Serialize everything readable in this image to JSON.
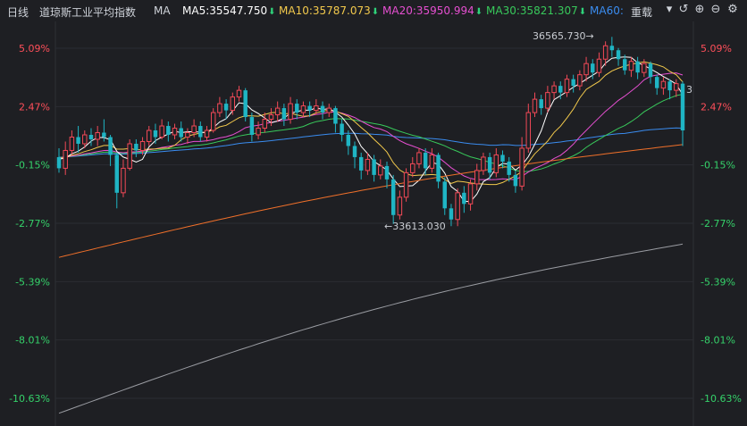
{
  "toolbar": {
    "period": "日线",
    "index_name": "道琼斯工业平均指数",
    "indicator": "MA",
    "ma5": "MA5:35547.750",
    "ma10": "MA10:35787.073",
    "ma20": "MA20:35950.994",
    "ma30": "MA30:35821.307",
    "ma60": "MA60:",
    "reset_label": "重载",
    "icons": [
      "undo-icon",
      "zoom-in-icon",
      "zoom-out-icon",
      "settings-icon"
    ]
  },
  "colors": {
    "background": "#1e1f23",
    "up": "#f24957",
    "down": "#1fb5c4",
    "ma5": "#ffffff",
    "ma10": "#f2c94c",
    "ma20": "#e64fd1",
    "ma30": "#38c95b",
    "ma60": "#3a8cf0",
    "ma120": "#f0702a",
    "ma250": "#9a9ca2",
    "up_text": "#ff4f5a",
    "down_text": "#35d26a"
  },
  "chart_data": {
    "type": "candlestick",
    "title": "道琼斯工业平均指数",
    "y_axis_ticks_left": [
      "5.09%",
      "2.47%",
      "-0.15%",
      "-2.77%",
      "-5.39%",
      "-8.01%",
      "-10.63%"
    ],
    "y_axis_ticks_right": [
      "5.09%",
      "2.47%",
      "-0.15%",
      "-2.77%",
      "-5.39%",
      "-8.01%",
      "-10.63%"
    ],
    "tick_values_pct": [
      5.09,
      2.47,
      -0.15,
      -2.77,
      -5.39,
      -8.01,
      -10.63
    ],
    "ylim_pct": [
      -11.2,
      5.6
    ],
    "annotations": {
      "high_label": "36565.730→",
      "high_value": 36565.73,
      "low_label": "←33613.030",
      "low_value": 33613.03,
      "right_edge_label": "3"
    },
    "candles": [
      [
        0.2,
        -0.3,
        0.6,
        -0.5
      ],
      [
        -0.3,
        0.5,
        0.9,
        -0.6
      ],
      [
        0.5,
        1.1,
        1.4,
        0.3
      ],
      [
        1.1,
        0.8,
        1.6,
        0.4
      ],
      [
        0.8,
        1.2,
        1.4,
        0.6
      ],
      [
        1.2,
        1.0,
        1.5,
        0.7
      ],
      [
        1.0,
        1.3,
        1.6,
        0.7
      ],
      [
        1.3,
        1.1,
        1.9,
        0.9
      ],
      [
        1.1,
        0.3,
        1.2,
        -0.2
      ],
      [
        0.3,
        -1.4,
        0.4,
        -2.1
      ],
      [
        -1.4,
        -0.3,
        0.1,
        -1.6
      ],
      [
        -0.3,
        0.8,
        1.0,
        -0.4
      ],
      [
        0.8,
        0.5,
        1.0,
        0.2
      ],
      [
        0.5,
        0.9,
        1.1,
        0.3
      ],
      [
        0.9,
        1.4,
        1.6,
        0.7
      ],
      [
        1.4,
        1.1,
        1.7,
        0.8
      ],
      [
        1.1,
        1.6,
        1.9,
        1.0
      ],
      [
        1.6,
        1.2,
        1.8,
        0.9
      ],
      [
        1.2,
        1.5,
        1.7,
        1.0
      ],
      [
        1.5,
        1.1,
        1.8,
        0.9
      ],
      [
        1.1,
        1.3,
        1.5,
        0.8
      ],
      [
        1.3,
        1.6,
        1.9,
        1.1
      ],
      [
        1.6,
        1.1,
        1.8,
        0.9
      ],
      [
        1.1,
        1.4,
        1.6,
        0.9
      ],
      [
        1.4,
        2.2,
        2.4,
        1.3
      ],
      [
        2.2,
        2.6,
        2.9,
        2.0
      ],
      [
        2.6,
        2.3,
        2.8,
        1.9
      ],
      [
        2.3,
        2.9,
        3.1,
        2.1
      ],
      [
        2.9,
        3.2,
        3.4,
        2.7
      ],
      [
        3.2,
        2.0,
        3.3,
        1.8
      ],
      [
        2.0,
        1.2,
        2.2,
        0.9
      ],
      [
        1.2,
        1.5,
        1.8,
        1.0
      ],
      [
        1.5,
        1.9,
        2.2,
        1.3
      ],
      [
        1.9,
        2.1,
        2.4,
        1.6
      ],
      [
        2.1,
        2.4,
        2.7,
        1.8
      ],
      [
        2.4,
        1.9,
        2.6,
        1.6
      ],
      [
        1.9,
        2.6,
        2.9,
        1.7
      ],
      [
        2.6,
        2.2,
        2.8,
        1.9
      ],
      [
        2.2,
        2.5,
        2.7,
        2.0
      ],
      [
        2.5,
        2.3,
        2.7,
        2.0
      ],
      [
        2.3,
        2.5,
        2.8,
        2.1
      ],
      [
        2.5,
        2.2,
        2.7,
        1.9
      ],
      [
        2.2,
        2.4,
        2.6,
        2.0
      ],
      [
        2.4,
        1.7,
        2.5,
        1.3
      ],
      [
        1.7,
        1.2,
        1.9,
        0.9
      ],
      [
        1.2,
        0.7,
        1.4,
        0.3
      ],
      [
        0.7,
        0.2,
        0.9,
        -0.3
      ],
      [
        0.2,
        -0.4,
        0.4,
        -0.8
      ],
      [
        -0.4,
        0.1,
        0.4,
        -0.6
      ],
      [
        0.1,
        -0.6,
        0.3,
        -0.9
      ],
      [
        -0.6,
        -0.2,
        0.1,
        -0.8
      ],
      [
        -0.2,
        -0.8,
        0.0,
        -1.2
      ],
      [
        -0.8,
        -2.4,
        -0.6,
        -2.8
      ],
      [
        -2.4,
        -1.6,
        -1.3,
        -2.6
      ],
      [
        -1.6,
        -0.5,
        -0.3,
        -1.8
      ],
      [
        -0.5,
        -0.1,
        0.2,
        -0.7
      ],
      [
        -0.1,
        0.4,
        0.6,
        -0.3
      ],
      [
        0.4,
        -0.3,
        0.6,
        -0.6
      ],
      [
        -0.3,
        0.3,
        0.6,
        -0.5
      ],
      [
        0.3,
        -0.9,
        0.4,
        -1.2
      ],
      [
        -0.9,
        -2.1,
        -0.7,
        -2.4
      ],
      [
        -2.1,
        -2.6,
        -1.9,
        -2.9
      ],
      [
        -2.6,
        -1.4,
        -1.2,
        -2.9
      ],
      [
        -1.4,
        -1.9,
        -1.1,
        -2.3
      ],
      [
        -1.9,
        -1.0,
        -0.8,
        -2.2
      ],
      [
        -1.0,
        -0.4,
        -0.1,
        -1.3
      ],
      [
        -0.4,
        0.2,
        0.4,
        -0.6
      ],
      [
        0.2,
        -0.5,
        0.4,
        -0.8
      ],
      [
        -0.5,
        0.3,
        0.6,
        -0.7
      ],
      [
        0.3,
        0.0,
        0.5,
        -0.3
      ],
      [
        0.0,
        -0.6,
        0.2,
        -0.9
      ],
      [
        -0.6,
        -1.1,
        -0.4,
        -1.4
      ],
      [
        -1.1,
        0.6,
        1.1,
        -1.3
      ],
      [
        0.6,
        2.2,
        2.6,
        0.4
      ],
      [
        2.2,
        2.8,
        3.1,
        2.0
      ],
      [
        2.8,
        2.4,
        3.0,
        2.1
      ],
      [
        2.4,
        3.1,
        3.4,
        2.2
      ],
      [
        3.1,
        3.4,
        3.6,
        2.8
      ],
      [
        3.4,
        3.1,
        3.6,
        2.8
      ],
      [
        3.1,
        3.7,
        3.9,
        2.9
      ],
      [
        3.7,
        3.4,
        3.9,
        3.1
      ],
      [
        3.4,
        3.9,
        4.1,
        3.2
      ],
      [
        3.9,
        4.4,
        4.7,
        3.6
      ],
      [
        4.4,
        4.0,
        4.6,
        3.7
      ],
      [
        4.0,
        4.6,
        4.9,
        3.8
      ],
      [
        4.6,
        5.2,
        5.4,
        4.3
      ],
      [
        5.2,
        5.0,
        5.6,
        4.7
      ],
      [
        5.0,
        4.6,
        5.1,
        4.3
      ],
      [
        4.6,
        4.1,
        4.8,
        3.9
      ],
      [
        4.1,
        4.5,
        4.7,
        3.8
      ],
      [
        4.5,
        4.0,
        4.7,
        3.7
      ],
      [
        4.0,
        4.4,
        4.6,
        3.8
      ],
      [
        4.4,
        3.8,
        4.5,
        3.5
      ],
      [
        3.8,
        3.3,
        3.9,
        3.0
      ],
      [
        3.3,
        3.6,
        3.8,
        3.0
      ],
      [
        3.6,
        3.2,
        3.7,
        2.8
      ],
      [
        3.2,
        3.5,
        3.7,
        2.9
      ],
      [
        3.5,
        1.4,
        3.6,
        0.7
      ]
    ],
    "ma_periods": [
      5,
      10,
      20,
      30,
      60,
      120,
      250
    ],
    "ma120_range_pct": [
      -4.3,
      1.3
    ],
    "ma250_range_pct": [
      -11.3,
      -2.9
    ]
  }
}
